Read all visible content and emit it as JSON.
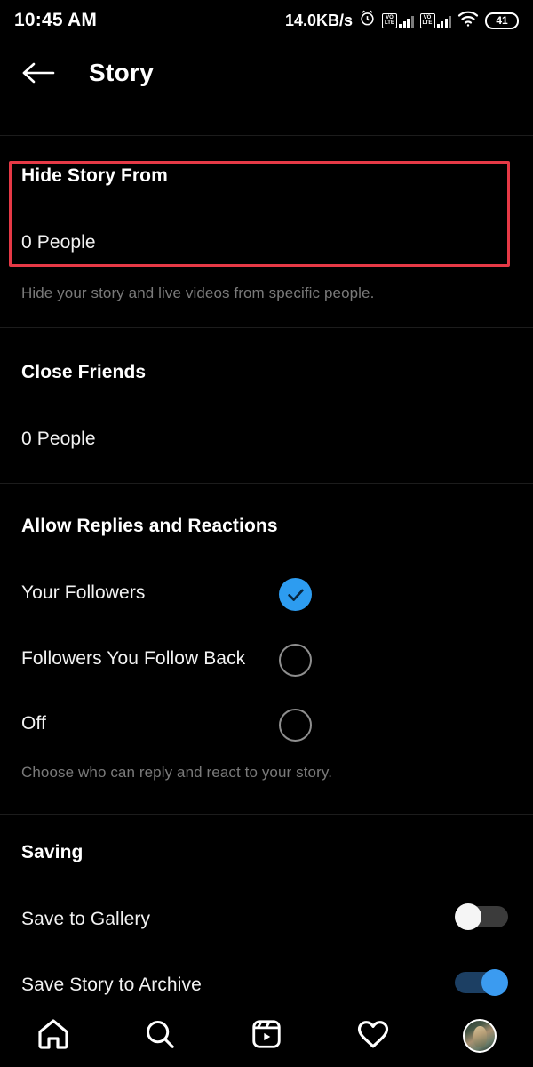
{
  "statusbar": {
    "time": "10:45 AM",
    "network_speed": "14.0KB/s",
    "alarm_icon": "alarm-clock-icon",
    "volte_label_top": "VO",
    "volte_label_bottom": "LTE",
    "wifi_icon": "wifi-icon",
    "battery_level": "41"
  },
  "header": {
    "back_icon": "back-arrow-icon",
    "title": "Story"
  },
  "sections": {
    "hide_story": {
      "title": "Hide Story From",
      "value": "0 People",
      "help": "Hide your story and live videos from specific people.",
      "highlight_color": "#e63946"
    },
    "close_friends": {
      "title": "Close Friends",
      "value": "0 People"
    },
    "allow_replies": {
      "title": "Allow Replies and Reactions",
      "help": "Choose who can reply and react to your story.",
      "options": [
        {
          "label": "Your Followers",
          "selected": true
        },
        {
          "label": "Followers You Follow Back",
          "selected": false
        },
        {
          "label": "Off",
          "selected": false
        }
      ],
      "accent_color": "#2d9cf0"
    },
    "saving": {
      "title": "Saving",
      "toggles": [
        {
          "label": "Save to Gallery",
          "on": false
        },
        {
          "label": "Save Story to Archive",
          "on": true
        }
      ],
      "on_color": "#3b9bf0"
    }
  },
  "bottom_nav": {
    "items": [
      {
        "name": "home-icon",
        "label": "Home"
      },
      {
        "name": "search-icon",
        "label": "Search"
      },
      {
        "name": "reels-icon",
        "label": "Reels"
      },
      {
        "name": "heart-icon",
        "label": "Activity"
      },
      {
        "name": "profile-avatar",
        "label": "Profile"
      }
    ]
  }
}
